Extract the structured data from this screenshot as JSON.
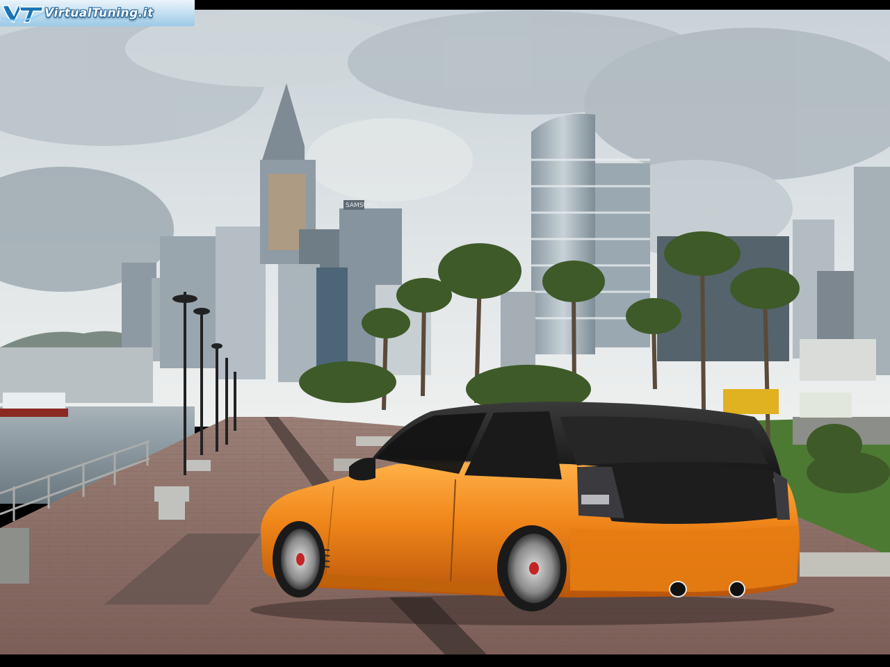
{
  "watermark": {
    "text": "VirtualTuning.it"
  },
  "building_signs": {
    "samsung": "SAMSUNG"
  },
  "colors": {
    "car_body": "#f0861a",
    "car_roof": "#1c1c1c",
    "sky": "#c7cfd4"
  }
}
